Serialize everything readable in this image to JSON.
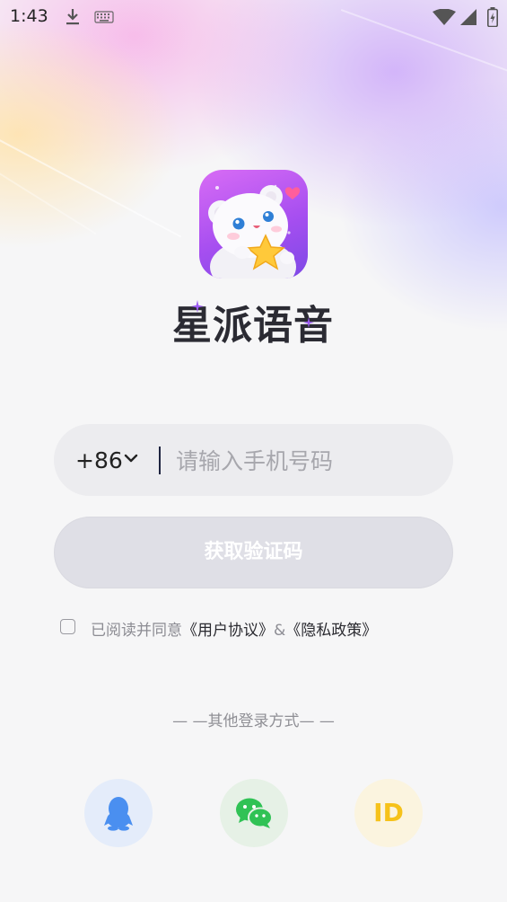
{
  "status_bar": {
    "time": "1:43"
  },
  "app": {
    "name": "星派语音"
  },
  "phone": {
    "country_code": "+86",
    "placeholder": "请输入手机号码",
    "value": ""
  },
  "get_code_button": {
    "label": "获取验证码"
  },
  "agreement": {
    "prefix": "已阅读并同意",
    "user_agreement": "《用户协议》",
    "connector": "&",
    "privacy_policy": "《隐私政策》",
    "checked": false
  },
  "other_login": {
    "title": "— —其他登录方式— —",
    "id_label": "ID"
  },
  "colors": {
    "qq": "#4a8ff0",
    "wechat": "#30c255",
    "id": "#f6c21a"
  }
}
